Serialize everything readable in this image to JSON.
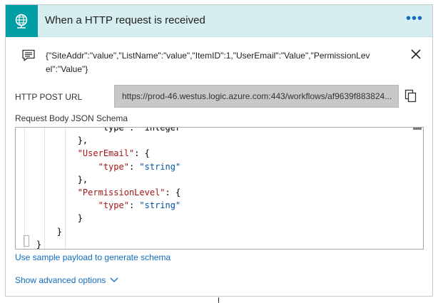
{
  "trigger": {
    "title": "When a HTTP request is received",
    "menu_label": "•••",
    "icon": "http-request-globe-icon",
    "accent_color": "#009da5",
    "header_bg": "#d6eef0"
  },
  "summary": {
    "icon": "comment-icon",
    "text": "{\"SiteAddr\":\"value\",\"ListName\":\"value\",\"ItemID\":1,\"UserEmail\":\"Value\",\"PermissionLevel\":\"Value\"}"
  },
  "url": {
    "label": "HTTP POST URL",
    "value": "https://prod-46.westus.logic.azure.com:443/workflows/af9639f883824...",
    "copy_icon": "copy-icon"
  },
  "schema": {
    "label": "Request Body JSON Schema",
    "lines": [
      {
        "parts": [
          {
            "t": "                \"type\": \"integer\"",
            "c": ""
          }
        ]
      },
      {
        "parts": [
          {
            "t": "            },",
            "c": ""
          }
        ]
      },
      {
        "parts": [
          {
            "t": "            ",
            "c": ""
          },
          {
            "t": "\"UserEmail\"",
            "c": "k"
          },
          {
            "t": ": {",
            "c": ""
          }
        ]
      },
      {
        "parts": [
          {
            "t": "                ",
            "c": ""
          },
          {
            "t": "\"type\"",
            "c": "k"
          },
          {
            "t": ": ",
            "c": ""
          },
          {
            "t": "\"string\"",
            "c": "s"
          }
        ]
      },
      {
        "parts": [
          {
            "t": "            },",
            "c": ""
          }
        ]
      },
      {
        "parts": [
          {
            "t": "            ",
            "c": ""
          },
          {
            "t": "\"PermissionLevel\"",
            "c": "k"
          },
          {
            "t": ": {",
            "c": ""
          }
        ]
      },
      {
        "parts": [
          {
            "t": "                ",
            "c": ""
          },
          {
            "t": "\"type\"",
            "c": "k"
          },
          {
            "t": ": ",
            "c": ""
          },
          {
            "t": "\"string\"",
            "c": "s"
          }
        ]
      },
      {
        "parts": [
          {
            "t": "            }",
            "c": ""
          }
        ]
      },
      {
        "parts": [
          {
            "t": "        }",
            "c": ""
          }
        ]
      },
      {
        "parts": [
          {
            "t": "    }",
            "c": ""
          }
        ]
      }
    ]
  },
  "links": {
    "sample_payload": "Use sample payload to generate schema",
    "advanced_options": "Show advanced options"
  }
}
